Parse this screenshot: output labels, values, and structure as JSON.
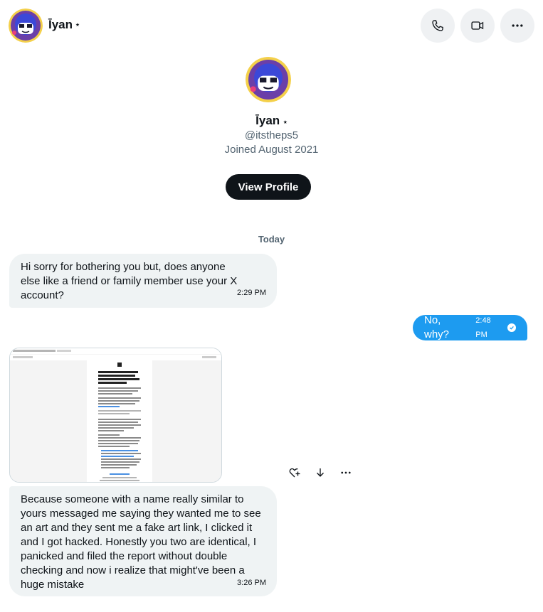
{
  "header": {
    "name": "Īyan",
    "star": "⭑",
    "call_icon": "phone-icon",
    "video_icon": "video-icon",
    "more_icon": "more-icon"
  },
  "profile": {
    "name": "Īyan",
    "star": "⭑",
    "handle": "@itstheps5",
    "joined": "Joined August 2021",
    "view_profile": "View Profile"
  },
  "day_separator": "Today",
  "messages": [
    {
      "text": "Hi sorry for bothering you but, does anyone else like a friend or family member use your X account?",
      "time": "2:29 PM",
      "direction": "incoming"
    },
    {
      "text": "No, why?",
      "time": "2:48 PM",
      "direction": "outgoing"
    },
    {
      "text": "Because someone with a name really similar to yours messaged me saying they wanted me to see an art and they sent me a fake art link, I clicked it and I got hacked. Honestly you two are identical, I panicked and filed the report without double checking and now i realize that might've been a huge mistake",
      "time": "3:26 PM",
      "direction": "incoming"
    }
  ],
  "attachment": {
    "heading": "We have noticed that you reported @Puyeh_chip for Fraud Activity/Illegal Purchase from a new device. Was this you?"
  },
  "message_actions": [
    "add-reaction-icon",
    "download-icon",
    "more-icon"
  ],
  "colors": {
    "accent": "#1d9bf0",
    "incoming_bubble": "#eff3f4",
    "text_primary": "#0f1419",
    "text_secondary": "#536471"
  }
}
